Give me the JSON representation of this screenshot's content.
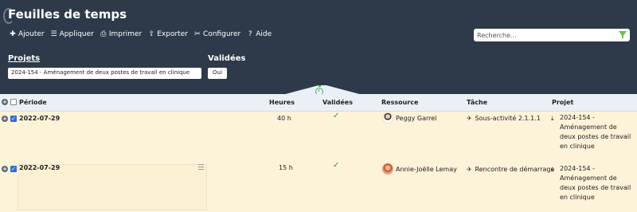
{
  "app": {
    "title": "Feuilles de temps"
  },
  "toolbar": {
    "add": "Ajouter",
    "apply": "Appliquer",
    "print": "Imprimer",
    "export": "Exporter",
    "configure": "Configurer",
    "help": "Aide"
  },
  "search": {
    "placeholder": "Recherche..."
  },
  "filters": {
    "projets_label": "Projets",
    "projets_value": "2024-154 - Aménagement de deux postes de travail en clinique",
    "validees_label": "Validées",
    "validees_value": "Oui"
  },
  "table": {
    "headers": {
      "periode": "Période",
      "heures": "Heures",
      "validees": "Validées",
      "ressource": "Ressource",
      "tache": "Tâche",
      "projet": "Projet"
    },
    "rows": [
      {
        "date": "2022-07-29",
        "hours": "40 h",
        "validated_mark": "✓",
        "resource": "Peggy Garrel",
        "task": "Sous-activité 2.1.1.1",
        "project": "2024-154 - Aménagement de deux postes de travail en clinique"
      },
      {
        "date": "2022-07-29",
        "hours": "15 h",
        "validated_mark": "✓",
        "resource": "Annie-Joëlle Lemay",
        "task": "Rencontre de démarrage",
        "project": "2024-154 - Aménagement de deux postes de travail en clinique"
      }
    ]
  },
  "colors": {
    "header_bg": "#2e3a4a",
    "row_bg": "#fdf3d9",
    "table_header_bg": "#eaf0f6",
    "accent_green": "#4caf50",
    "checkbox_blue": "#2a6fd6"
  }
}
